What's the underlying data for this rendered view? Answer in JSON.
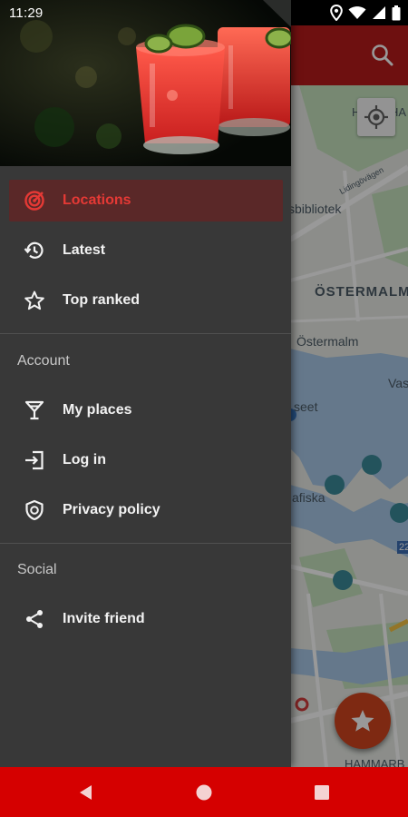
{
  "status_bar": {
    "time": "11:29",
    "icons": [
      "location-icon",
      "wifi-icon",
      "signal-icon",
      "battery-icon"
    ]
  },
  "app_bar": {
    "color": "#b71c1c",
    "search_icon": "search-icon"
  },
  "map": {
    "labels": {
      "library": "sbibliotek",
      "district": "ÖSTERMALM",
      "ostermalm": "Östermalm",
      "museum_cut": "seet",
      "vasa_cut": "Vas",
      "grafiska_cut": "afiska",
      "hammarby": "HAMMARB",
      "hackney": "H",
      "hackney2": "HA",
      "road_22": "22",
      "street_small": "Lidingövägen"
    },
    "fab_icon": "star-icon",
    "locate_icon": "my-location-icon"
  },
  "drawer": {
    "header_image": "drinks-photo",
    "primary_items": [
      {
        "label": "Locations",
        "icon": "radar-icon",
        "active": true
      },
      {
        "label": "Latest",
        "icon": "history-icon",
        "active": false
      },
      {
        "label": "Top ranked",
        "icon": "star-outline-icon",
        "active": false
      }
    ],
    "account": {
      "header": "Account",
      "items": [
        {
          "label": "My places",
          "icon": "cocktail-glass-icon"
        },
        {
          "label": "Log in",
          "icon": "login-icon"
        },
        {
          "label": "Privacy policy",
          "icon": "shield-icon"
        }
      ]
    },
    "social": {
      "header": "Social",
      "items": [
        {
          "label": "Invite friend",
          "icon": "share-icon"
        }
      ]
    },
    "accent_color": "#e53935"
  },
  "nav_bar": {
    "color": "#d50000",
    "buttons": [
      "back-icon",
      "home-icon",
      "recents-icon"
    ]
  }
}
